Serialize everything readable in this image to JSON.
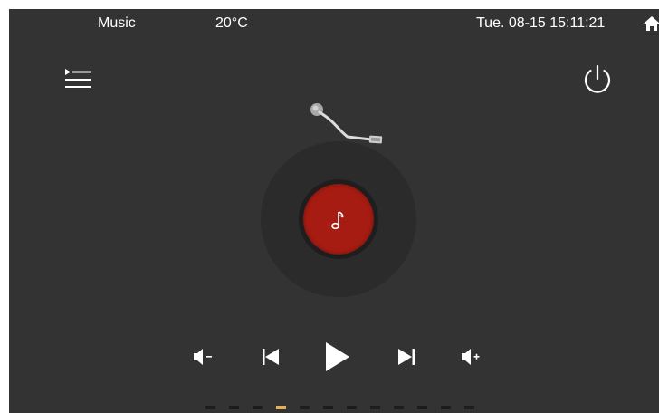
{
  "status_bar": {
    "app_name": "Music",
    "temperature": "20°C",
    "datetime": "Tue. 08-15 15:11:21",
    "home_icon": "home-icon"
  },
  "top_controls": {
    "playlist_icon": "playlist-icon",
    "power_icon": "power-icon"
  },
  "player": {
    "record_color": "#a71c12",
    "center_icon": "music-note-icon",
    "tonearm": "tonearm"
  },
  "controls": [
    {
      "name": "volume-down",
      "icon": "volume-down-icon"
    },
    {
      "name": "previous",
      "icon": "previous-icon"
    },
    {
      "name": "play",
      "icon": "play-icon"
    },
    {
      "name": "next",
      "icon": "next-icon"
    },
    {
      "name": "volume-up",
      "icon": "volume-up-icon"
    }
  ],
  "page_indicator": {
    "total": 12,
    "active_index": 3,
    "active_color": "#e0b25c"
  },
  "colors": {
    "background": "#333333",
    "text": "#ffffff"
  }
}
